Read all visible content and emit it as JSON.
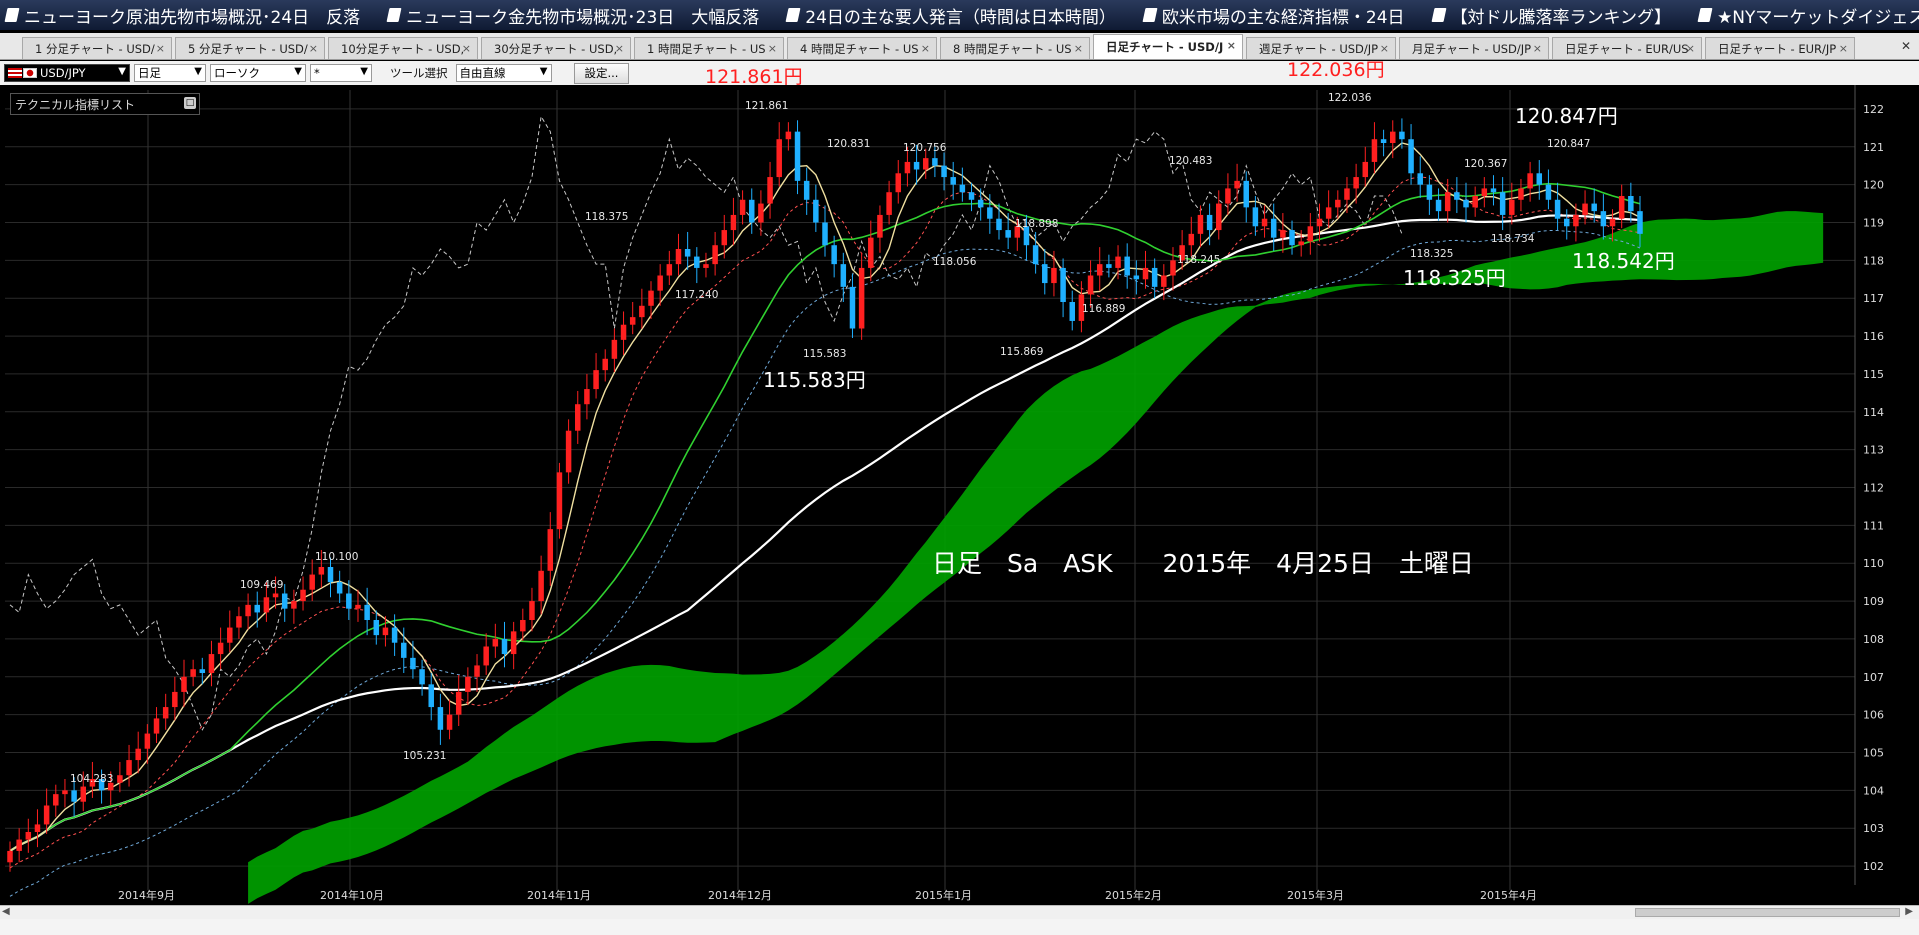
{
  "news": [
    "ニューヨーク原油先物市場概況･24日　反落",
    "ニューヨーク金先物市場概況･23日　大幅反落",
    "24日の主な要人発言（時間は日本時間）",
    "欧米市場の主な経済指標・24日",
    "【対ドル騰落率ランキング】",
    "★NYマーケットダイジェスト"
  ],
  "tabs": [
    {
      "label": "1 分足チャート - USD/"
    },
    {
      "label": "5 分足チャート - USD/"
    },
    {
      "label": "10分足チャート - USD,"
    },
    {
      "label": "30分足チャート - USD,"
    },
    {
      "label": "1 時間足チャート - US"
    },
    {
      "label": "4 時間足チャート - US"
    },
    {
      "label": "8 時間足チャート - US"
    },
    {
      "label": "日足チャート - USD/J",
      "active": true
    },
    {
      "label": "週足チャート - USD/JP"
    },
    {
      "label": "月足チャート - USD/JP"
    },
    {
      "label": "日足チャート - EUR/US"
    },
    {
      "label": "日足チャート - EUR/JP"
    }
  ],
  "toolbar": {
    "pair": "USD/JPY",
    "timeframe": "日足",
    "chart_type": "ローソク",
    "style": "*",
    "tool_label": "ツール選択",
    "tool_value": "自由直線",
    "settings": "設定..."
  },
  "indicator_list_label": "テクニカル指標リスト",
  "header_prices": {
    "high_1": "121.861円",
    "high_2": "122.036円"
  },
  "annotations": {
    "caption": "日足　Sa　ASK　　2015年　4月25日　土曜日",
    "big_labels": [
      "120.847円",
      "118.325円",
      "118.542円",
      "115.583円"
    ]
  },
  "colors": {
    "up": "#ff2020",
    "down": "#1fb0ff",
    "cloud_bull": "#00a000",
    "cloud_bear": "#1a8fa0",
    "ma_short": "#f0e0a0",
    "ma_mid": "#30d030",
    "ma_long": "#ffffff",
    "chikou": "#c8c8c8",
    "dash_red": "#ff5050",
    "dash_blue": "#6fa8d8",
    "grid": "#2a2a2a"
  },
  "chart_data": {
    "type": "candlestick",
    "symbol": "USD/JPY",
    "timeframe": "日足",
    "y_axis": {
      "min": 101.5,
      "max": 122.5,
      "ticks": [
        102,
        103,
        104,
        105,
        106,
        107,
        108,
        109,
        110,
        111,
        112,
        113,
        114,
        115,
        116,
        117,
        118,
        119,
        120,
        121,
        122
      ]
    },
    "x_axis_labels": [
      "2014年9月",
      "2014年10月",
      "2014年11月",
      "2014年12月",
      "2015年1月",
      "2015年2月",
      "2015年3月",
      "2015年4月"
    ],
    "point_labels": [
      "104.283",
      "109.469",
      "110.100",
      "105.231",
      "118.375",
      "117.240",
      "121.861",
      "115.583",
      "120.831",
      "120.756",
      "118.056",
      "118.898",
      "115.869",
      "116.889",
      "120.483",
      "118.245",
      "122.036",
      "120.367",
      "118.325",
      "120.847",
      "118.734"
    ],
    "closes": [
      102.4,
      102.7,
      102.9,
      103.1,
      103.6,
      103.9,
      104.0,
      103.7,
      104.1,
      104.3,
      104.0,
      104.2,
      104.4,
      104.8,
      105.1,
      105.5,
      105.9,
      106.2,
      106.6,
      107.0,
      107.2,
      107.1,
      107.6,
      107.9,
      108.3,
      108.6,
      108.9,
      108.7,
      109.1,
      109.2,
      108.8,
      109.0,
      109.3,
      109.7,
      109.9,
      109.5,
      109.2,
      108.8,
      108.9,
      108.5,
      108.1,
      108.3,
      107.9,
      107.5,
      107.2,
      106.8,
      106.2,
      105.6,
      106.0,
      106.6,
      107.0,
      107.3,
      107.8,
      108.0,
      107.6,
      108.2,
      108.5,
      109.0,
      109.8,
      110.9,
      112.4,
      113.5,
      114.2,
      114.6,
      115.1,
      115.4,
      115.9,
      116.3,
      116.5,
      116.8,
      117.2,
      117.6,
      117.9,
      118.3,
      118.1,
      117.8,
      117.9,
      118.4,
      118.8,
      119.2,
      119.6,
      119.0,
      119.5,
      120.2,
      121.2,
      121.4,
      120.1,
      119.6,
      119.0,
      118.4,
      117.9,
      117.3,
      116.2,
      117.8,
      118.6,
      119.2,
      119.8,
      120.3,
      120.6,
      120.4,
      120.7,
      120.5,
      120.2,
      120.0,
      119.8,
      119.6,
      119.4,
      119.1,
      118.8,
      118.6,
      118.9,
      118.4,
      117.9,
      117.4,
      117.8,
      116.9,
      116.4,
      117.1,
      117.6,
      117.9,
      117.8,
      118.1,
      117.6,
      117.5,
      117.8,
      117.3,
      117.6,
      118.0,
      118.4,
      118.7,
      119.2,
      118.8,
      119.5,
      119.9,
      120.1,
      119.4,
      118.9,
      119.1,
      118.6,
      118.8,
      118.4,
      118.5,
      118.9,
      119.1,
      119.4,
      119.6,
      119.9,
      120.2,
      120.6,
      121.2,
      121.1,
      121.4,
      121.2,
      120.3,
      120.0,
      119.6,
      119.3,
      119.8,
      119.6,
      119.4,
      119.7,
      119.9,
      119.8,
      119.2,
      119.6,
      119.9,
      120.3,
      120.0,
      119.6,
      119.1,
      118.9,
      119.2,
      119.5,
      119.3,
      118.9,
      119.1,
      119.7,
      119.3,
      118.7
    ]
  }
}
